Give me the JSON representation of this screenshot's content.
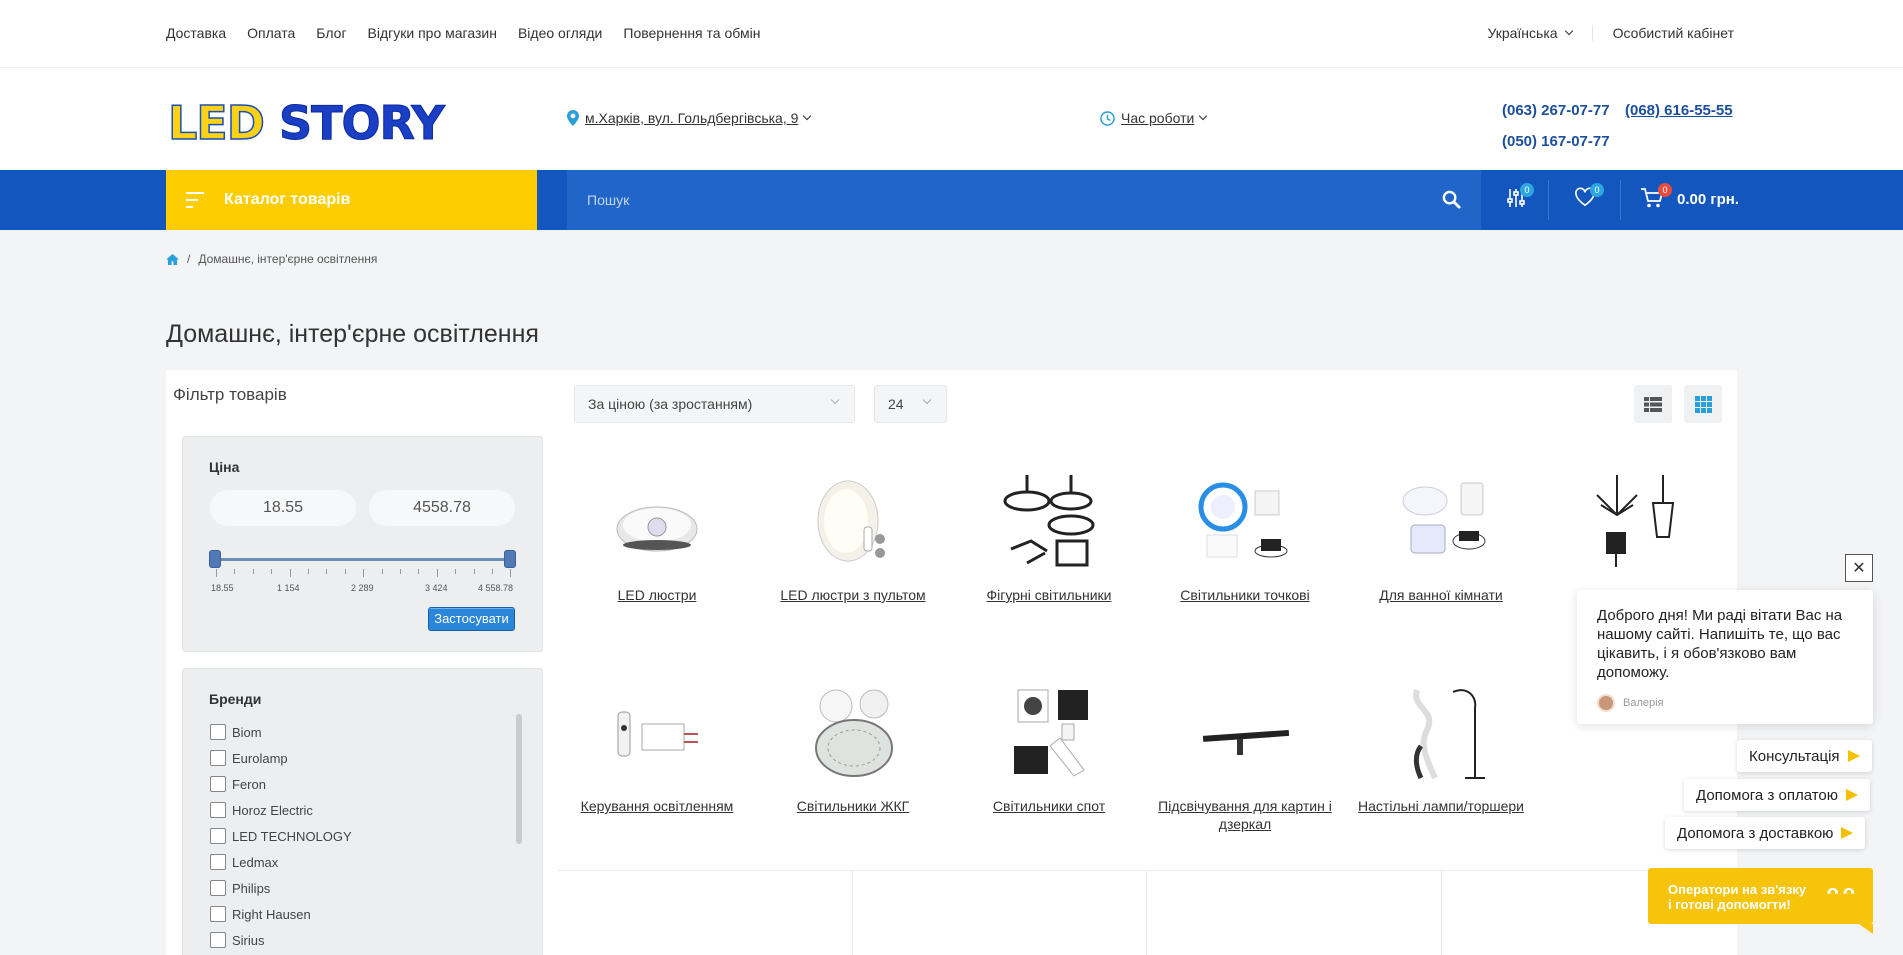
{
  "topnav": {
    "links": [
      "Доставка",
      "Оплата",
      "Блог",
      "Відгуки про магазин",
      "Відео огляди",
      "Повернення та обмін"
    ],
    "language": "Українська",
    "account": "Особистий кабінет"
  },
  "header": {
    "logo_part1": "LED",
    "logo_part2": "STORY",
    "address": "м.Харків, вул. Гольдбергівська, 9",
    "hours": "Час роботи",
    "phone1": "(063) 267-07-77",
    "phone2": "(068) 616-55-55",
    "phone3": "(050) 167-07-77"
  },
  "bar": {
    "catalog": "Каталог товарів",
    "search_placeholder": "Пошук",
    "compare_count": "0",
    "wishlist_count": "0",
    "cart_count": "0",
    "cart_total": "0.00 грн."
  },
  "breadcrumb": {
    "separator": "/",
    "current": "Домашнє, інтер'єрне освітлення"
  },
  "page_title": "Домашнє, інтер'єрне освітлення",
  "filter": {
    "title": "Фільтр товарів",
    "price_label": "Ціна",
    "price_min": "18.55",
    "price_max": "4558.78",
    "ticks": [
      "18.55",
      "1 154",
      "2 289",
      "3 424",
      "4 558.78"
    ],
    "apply": "Застосувати",
    "brands_label": "Бренди",
    "brands": [
      "Biom",
      "Eurolamp",
      "Feron",
      "Horoz Electric",
      "LED TECHNOLOGY",
      "Ledmax",
      "Philips",
      "Right Hausen",
      "Sirius"
    ]
  },
  "toolbar": {
    "sort": "За ціною (за зростанням)",
    "limit": "24"
  },
  "categories": [
    "LED люстри",
    "LED люстри з пультом",
    "Фігурні світильники",
    "Світильники точкові",
    "Для ванної кімнати",
    "",
    "Керування освітленням",
    "Світильники ЖКГ",
    "Світильники спот",
    "Підсвічування для картин і дзеркал",
    "Настільні лампи/торшери"
  ],
  "chat": {
    "message": "Доброго дня! Ми раді вітати Вас на нашому сайті. Напишіть те, що вас цікавить, і я обов'язково вам допоможу.",
    "agent": "Валерія",
    "close": "✕"
  },
  "quick": [
    "Консультація",
    "Допомога з оплатою",
    "Допомога з доставкою"
  ],
  "operators": "Оператори на зв'язку і готові допомогти!",
  "colors": {
    "accent_blue": "#1356bd",
    "accent_yellow": "#fecd00",
    "phone_blue": "#1b4f9d"
  }
}
